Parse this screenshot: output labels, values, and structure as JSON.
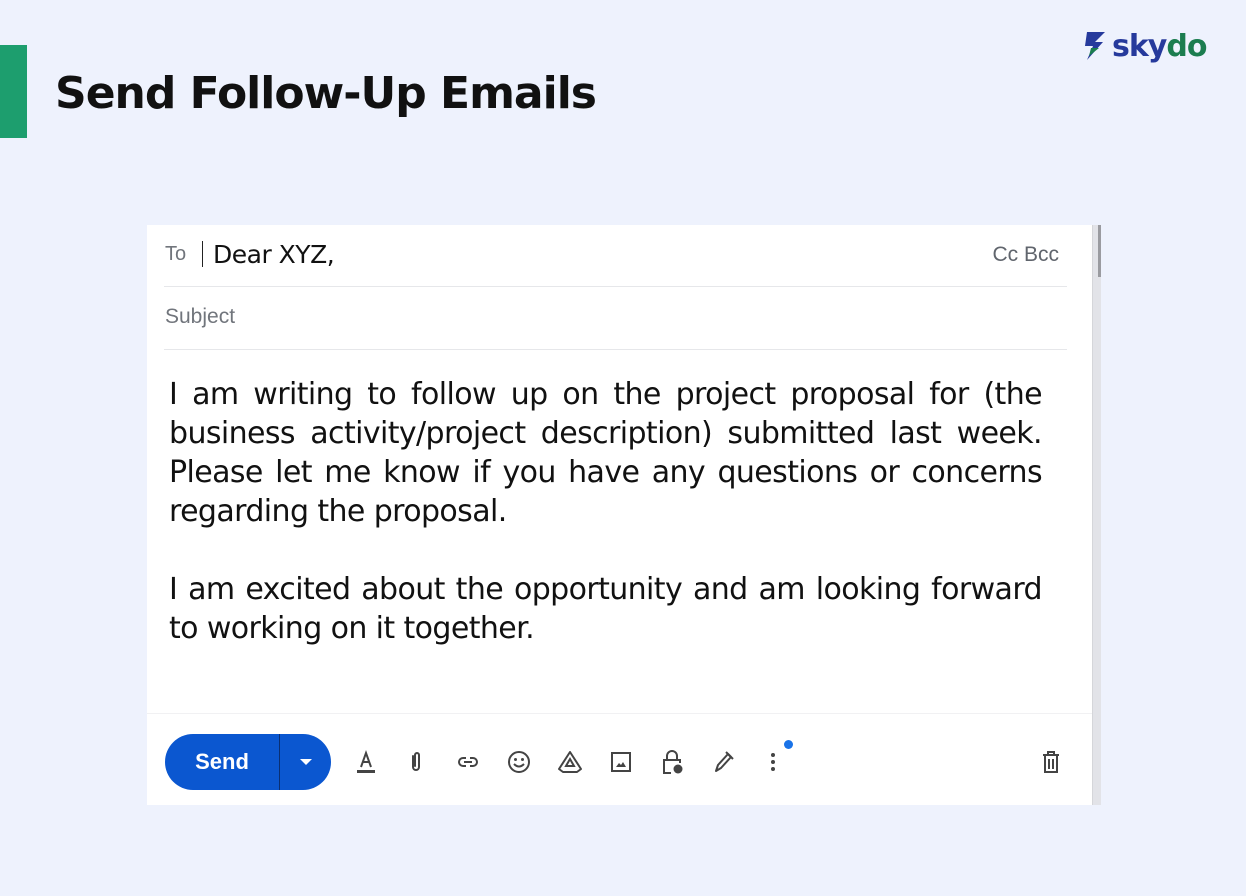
{
  "header": {
    "title": "Send Follow-Up Emails",
    "accent_color": "#1d9e6e",
    "logo": {
      "part1": "sky",
      "part2": "do",
      "color1": "#263a9c",
      "color2": "#1b7d4f"
    }
  },
  "compose": {
    "to_label": "To",
    "to_value": "Dear XYZ,",
    "cc_bcc_label": "Cc Bcc",
    "subject_placeholder": "Subject",
    "body_paragraphs": [
      "I am writing to follow up on the project proposal for (the business activity/project description) submitted last week. Please let me know if you have any questions or concerns regarding the proposal.",
      "I am excited about the opportunity and am looking forward to working on it together."
    ],
    "toolbar": {
      "send_label": "Send",
      "send_color": "#0b57d0",
      "icons": [
        "formatting-icon",
        "attach-icon",
        "link-icon",
        "emoji-icon",
        "drive-icon",
        "photo-icon",
        "confidential-icon",
        "signature-icon",
        "more-options-icon",
        "delete-icon"
      ]
    }
  }
}
